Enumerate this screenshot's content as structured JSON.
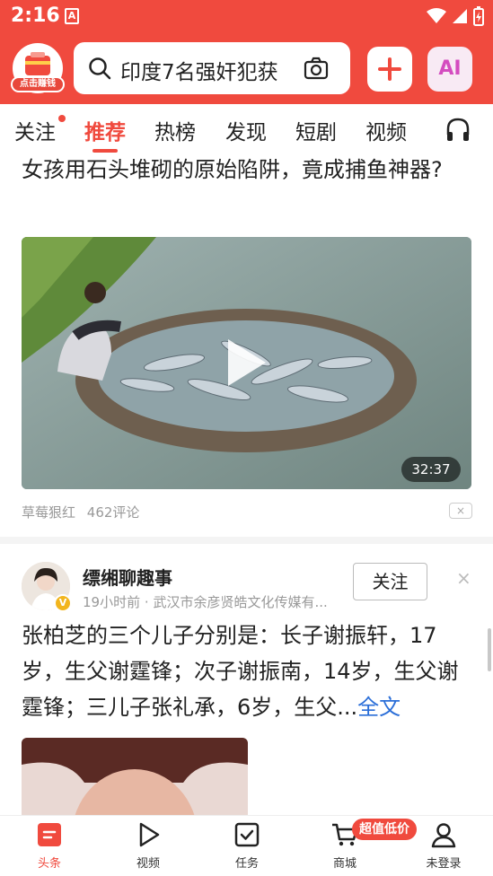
{
  "status_bar": {
    "time": "2:16",
    "app_indicator": "A"
  },
  "header": {
    "logo_badge": "点击赚钱",
    "search": {
      "text": "印度7名强奸犯获"
    },
    "ai_label": "AI"
  },
  "tabs": [
    {
      "label": "关注",
      "has_dot": true
    },
    {
      "label": "推荐",
      "active": true
    },
    {
      "label": "热榜"
    },
    {
      "label": "发现"
    },
    {
      "label": "短剧"
    },
    {
      "label": "视频"
    }
  ],
  "article1": {
    "title": "女孩用石头堆砌的原始陷阱，竟成捕鱼神器?",
    "duration": "32:37",
    "source": "草莓狠红",
    "comments": "462评论",
    "dislike": "×"
  },
  "article2": {
    "author": "缥缃聊趣事",
    "verified": "V",
    "time_ago": "19小时前",
    "separator": "·",
    "org": "武汉市余彦贤皓文化传媒有...",
    "follow_label": "关注",
    "close": "×",
    "text": "张柏芝的三个儿子分别是：长子谢振轩，17岁，生父谢霆锋；次子谢振南，14岁，生父谢霆锋；三儿子张礼承，6岁，生父...",
    "fulltext_label": "全文"
  },
  "bottom_nav": [
    {
      "label": "头条",
      "icon": "headlines-icon",
      "active": true
    },
    {
      "label": "视频",
      "icon": "play-icon"
    },
    {
      "label": "任务",
      "icon": "task-check-icon"
    },
    {
      "label": "商城",
      "icon": "cart-icon"
    },
    {
      "label": "未登录",
      "icon": "user-icon"
    }
  ],
  "promo_badge": "超值低价",
  "colors": {
    "brand_red": "#f04a3e",
    "link_blue": "#2a6ed8",
    "meta_gray": "#999999"
  }
}
